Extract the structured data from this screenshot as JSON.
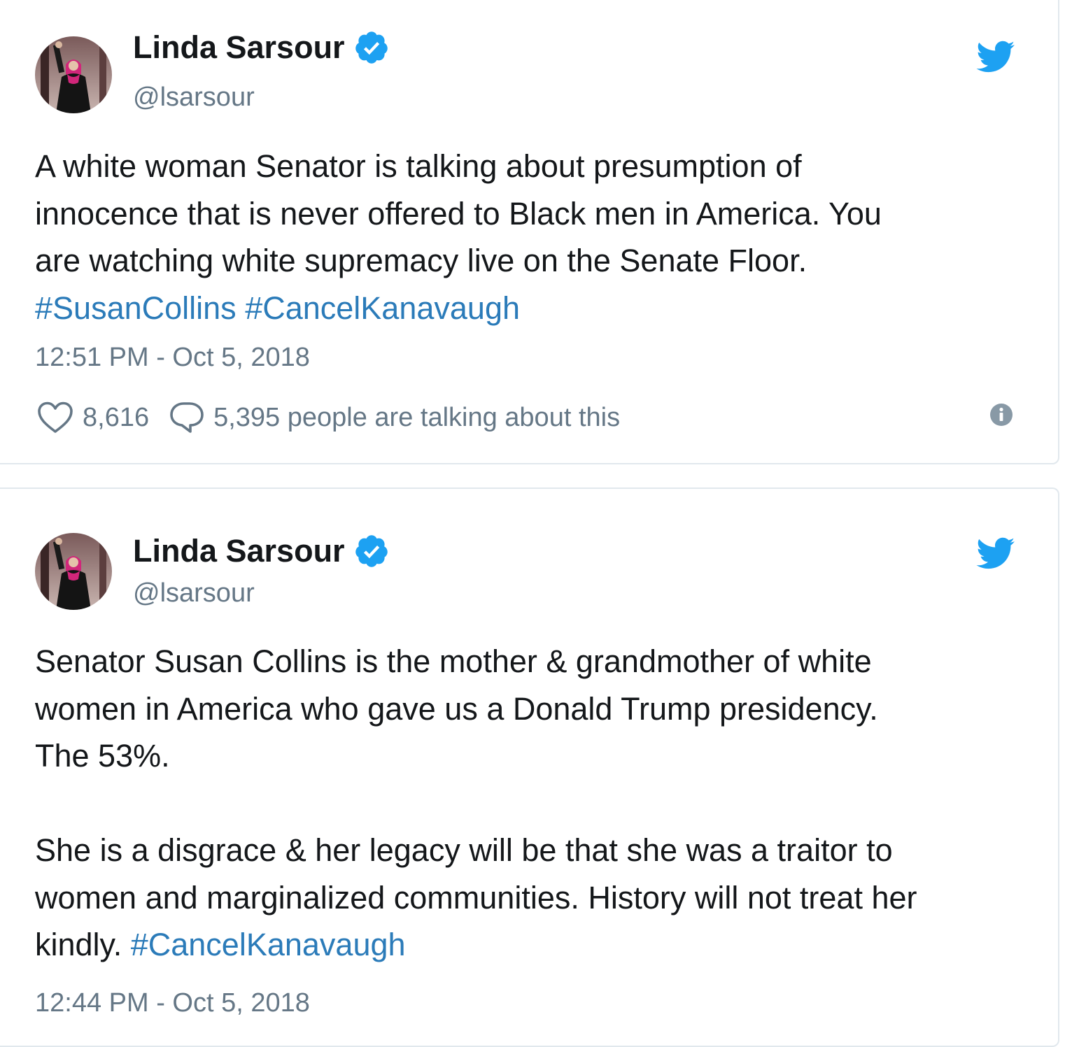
{
  "tweets": [
    {
      "author": {
        "name": "Linda Sarsour",
        "handle": "@lsarsour",
        "verified": true
      },
      "text_lines": [
        {
          "segments": [
            {
              "text": "A white woman Senator is talking about presumption of",
              "type": "text"
            }
          ]
        },
        {
          "segments": [
            {
              "text": "innocence that is never offered to Black men in America. You",
              "type": "text"
            }
          ]
        },
        {
          "segments": [
            {
              "text": "are watching white supremacy live on the Senate Floor.",
              "type": "text"
            }
          ]
        },
        {
          "segments": [
            {
              "text": "#SusanCollins",
              "type": "hashtag"
            },
            {
              "text": " ",
              "type": "text"
            },
            {
              "text": "#CancelKanavaugh",
              "type": "hashtag"
            }
          ]
        }
      ],
      "timestamp": "12:51 PM - Oct 5, 2018",
      "likes": "8,616",
      "talking": "5,395 people are talking about this"
    },
    {
      "author": {
        "name": "Linda Sarsour",
        "handle": "@lsarsour",
        "verified": true
      },
      "text_lines": [
        {
          "segments": [
            {
              "text": "Senator Susan Collins is the mother & grandmother of white",
              "type": "text"
            }
          ]
        },
        {
          "segments": [
            {
              "text": "women in America who gave us a Donald Trump presidency.",
              "type": "text"
            }
          ]
        },
        {
          "segments": [
            {
              "text": "The 53%.",
              "type": "text"
            }
          ]
        },
        {
          "segments": []
        },
        {
          "segments": [
            {
              "text": "She is a disgrace & her legacy will be that she was a traitor to",
              "type": "text"
            }
          ]
        },
        {
          "segments": [
            {
              "text": "women and marginalized communities. History will not treat her",
              "type": "text"
            }
          ]
        },
        {
          "segments": [
            {
              "text": "kindly. ",
              "type": "text"
            },
            {
              "text": "#CancelKanavaugh",
              "type": "hashtag"
            }
          ]
        }
      ],
      "timestamp": "12:44 PM - Oct 5, 2018"
    }
  ],
  "icons": {
    "verified": "verified-badge-icon",
    "brand": "twitter-bird-icon",
    "like": "heart-icon",
    "reply": "reply-bubble-icon",
    "info": "info-icon"
  },
  "colors": {
    "text": "#14171a",
    "secondary": "#657786",
    "hashtag": "#2b7bb9",
    "twitter_blue": "#1da1f2",
    "border": "#e1e8ed"
  }
}
